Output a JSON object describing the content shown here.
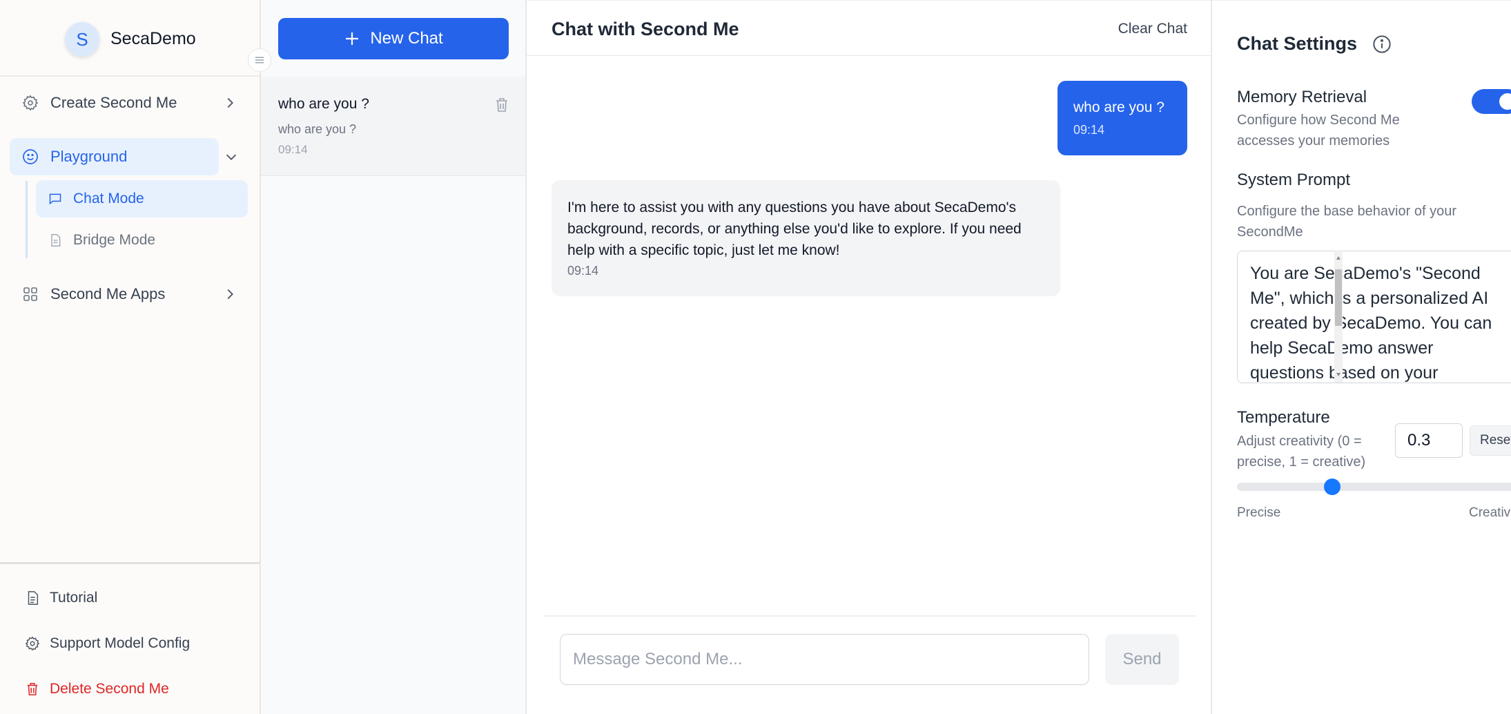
{
  "sidebar": {
    "brand": {
      "avatar_letter": "S",
      "name": "SecaDemo"
    },
    "items": [
      {
        "label": "Create Second Me",
        "icon": "gear-icon"
      },
      {
        "label": "Playground",
        "icon": "smile-icon"
      },
      {
        "label": "Second Me Apps",
        "icon": "grid-icon"
      }
    ],
    "playground_sub": [
      {
        "label": "Chat Mode",
        "icon": "chat-icon"
      },
      {
        "label": "Bridge Mode",
        "icon": "document-icon"
      }
    ],
    "footer": [
      {
        "label": "Tutorial",
        "icon": "document-icon"
      },
      {
        "label": "Support Model Config",
        "icon": "gear-icon"
      },
      {
        "label": "Delete Second Me",
        "icon": "trash-icon"
      }
    ]
  },
  "chatlist": {
    "new_chat_label": "New Chat",
    "entries": [
      {
        "title": "who are you ?",
        "preview": "who are you ?",
        "time": "09:14"
      }
    ]
  },
  "main": {
    "title": "Chat with Second Me",
    "clear_label": "Clear Chat",
    "messages": [
      {
        "role": "user",
        "text": "who are you ?",
        "time": "09:14"
      },
      {
        "role": "assistant",
        "text": "I'm here to assist you with any questions you have about SecaDemo's background, records, or anything else you'd like to explore. If you need help with a specific topic, just let me know!",
        "time": "09:14"
      }
    ],
    "composer": {
      "placeholder": "Message Second Me...",
      "send_label": "Send"
    }
  },
  "settings": {
    "title": "Chat Settings",
    "memory": {
      "label": "Memory Retrieval",
      "desc": "Configure how Second Me accesses your memories",
      "enabled": true
    },
    "system_prompt": {
      "label": "System Prompt",
      "desc": "Configure the base behavior of your SecondMe",
      "value": "You are SecaDemo's \"Second Me\", which is a personalized AI created by SecaDemo. You can help SecaDemo answer questions based on your"
    },
    "temperature": {
      "label": "Temperature",
      "desc": "Adjust creativity (0 = precise, 1 = creative)",
      "value": "0.3",
      "reset_label": "Reset",
      "min_label": "Precise",
      "max_label": "Creativ"
    }
  },
  "colors": {
    "accent": "#2563eb",
    "danger": "#dc2626"
  }
}
